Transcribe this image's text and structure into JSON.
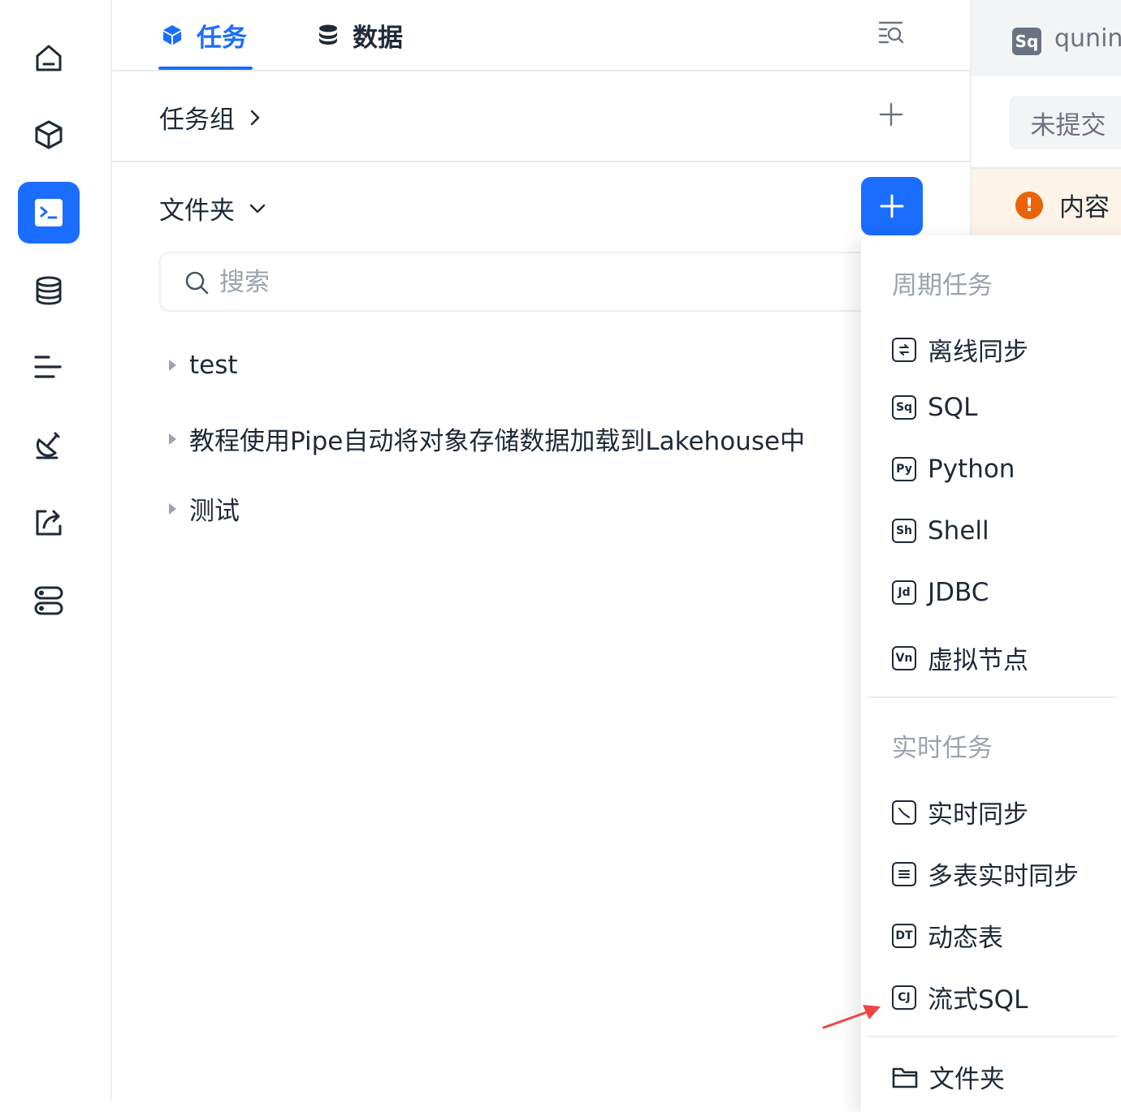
{
  "colors": {
    "accent": "#1a6dff",
    "warning": "#e8630a",
    "arrow": "#ef4444"
  },
  "sidebar": {
    "items": [
      {
        "icon": "home-icon",
        "active": false
      },
      {
        "icon": "cube-icon",
        "active": false
      },
      {
        "icon": "terminal-icon",
        "active": true
      },
      {
        "icon": "database-icon",
        "active": false
      },
      {
        "icon": "gantt-icon",
        "active": false
      },
      {
        "icon": "satellite-icon",
        "active": false
      },
      {
        "icon": "share-icon",
        "active": false
      },
      {
        "icon": "server-icon",
        "active": false
      }
    ]
  },
  "tabs": [
    {
      "label": "任务",
      "icon": "cube-icon",
      "active": true
    },
    {
      "label": "数据",
      "icon": "database-icon",
      "active": false
    }
  ],
  "task_group": {
    "label": "任务组"
  },
  "folder": {
    "label": "文件夹"
  },
  "search": {
    "placeholder": "搜索",
    "value": ""
  },
  "tree": [
    {
      "label": "test"
    },
    {
      "label": "教程使用Pipe自动将对象存储数据加载到Lakehouse中"
    },
    {
      "label": "测试"
    }
  ],
  "right_panel": {
    "badge": "Sq",
    "name": "qunin",
    "status": "未提交",
    "warning_icon": "!",
    "warning_text": "内容"
  },
  "dropdown": {
    "group_periodic": "周期任务",
    "periodic_items": [
      {
        "icon": "offline-sync-icon",
        "icon_text": "",
        "label": "离线同步"
      },
      {
        "icon": "sql-icon",
        "icon_text": "Sq",
        "label": "SQL"
      },
      {
        "icon": "python-icon",
        "icon_text": "Py",
        "label": "Python"
      },
      {
        "icon": "shell-icon",
        "icon_text": "Sh",
        "label": "Shell"
      },
      {
        "icon": "jdbc-icon",
        "icon_text": "Jd",
        "label": "JDBC"
      },
      {
        "icon": "virtual-node-icon",
        "icon_text": "Vn",
        "label": "虚拟节点"
      }
    ],
    "group_realtime": "实时任务",
    "realtime_items": [
      {
        "icon": "realtime-sync-icon",
        "icon_text": "",
        "label": "实时同步"
      },
      {
        "icon": "multi-table-sync-icon",
        "icon_text": "",
        "label": "多表实时同步"
      },
      {
        "icon": "dynamic-table-icon",
        "icon_text": "DT",
        "label": "动态表"
      },
      {
        "icon": "streaming-sql-icon",
        "icon_text": "CJ",
        "label": "流式SQL"
      }
    ],
    "folder_item": {
      "icon": "folder-icon",
      "label": "文件夹"
    }
  }
}
